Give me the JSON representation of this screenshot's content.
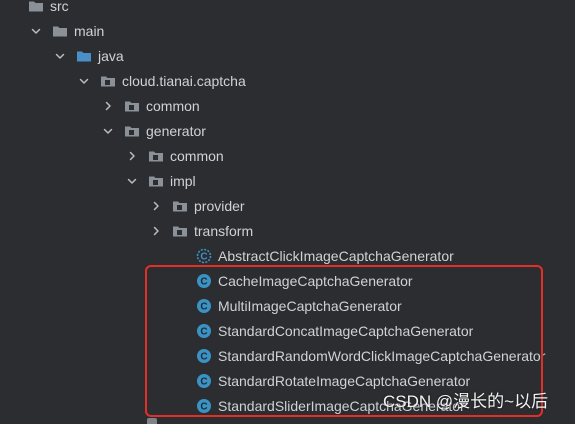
{
  "tree": {
    "nodes": [
      {
        "label": "src",
        "indent": 0,
        "chevron": "none",
        "icon": "folder-gray"
      },
      {
        "label": "main",
        "indent": 1,
        "chevron": "down",
        "icon": "folder-gray"
      },
      {
        "label": "java",
        "indent": 2,
        "chevron": "down",
        "icon": "folder-blue"
      },
      {
        "label": "cloud.tianai.captcha",
        "indent": 3,
        "chevron": "down",
        "icon": "package"
      },
      {
        "label": "common",
        "indent": 4,
        "chevron": "right",
        "icon": "package"
      },
      {
        "label": "generator",
        "indent": 4,
        "chevron": "down",
        "icon": "package"
      },
      {
        "label": "common",
        "indent": 5,
        "chevron": "right",
        "icon": "package"
      },
      {
        "label": "impl",
        "indent": 5,
        "chevron": "down",
        "icon": "package"
      },
      {
        "label": "provider",
        "indent": 6,
        "chevron": "right",
        "icon": "package"
      },
      {
        "label": "transform",
        "indent": 6,
        "chevron": "right",
        "icon": "package"
      },
      {
        "label": "AbstractClickImageCaptchaGenerator",
        "indent": 7,
        "chevron": "none",
        "icon": "abstract-class"
      },
      {
        "label": "CacheImageCaptchaGenerator",
        "indent": 7,
        "chevron": "none",
        "icon": "class"
      },
      {
        "label": "MultiImageCaptchaGenerator",
        "indent": 7,
        "chevron": "none",
        "icon": "class"
      },
      {
        "label": "StandardConcatImageCaptchaGenerator",
        "indent": 7,
        "chevron": "none",
        "icon": "class"
      },
      {
        "label": "StandardRandomWordClickImageCaptchaGenerator",
        "indent": 7,
        "chevron": "none",
        "icon": "class"
      },
      {
        "label": "StandardRotateImageCaptchaGenerator",
        "indent": 7,
        "chevron": "none",
        "icon": "class"
      },
      {
        "label": "StandardSliderImageCaptchaGenerator",
        "indent": 7,
        "chevron": "none",
        "icon": "class"
      }
    ]
  },
  "watermark": "CSDN @漫长的~以后",
  "colors": {
    "background": "#2b2d30",
    "class_icon": "#3a93c4",
    "highlight_border": "#e33027"
  }
}
